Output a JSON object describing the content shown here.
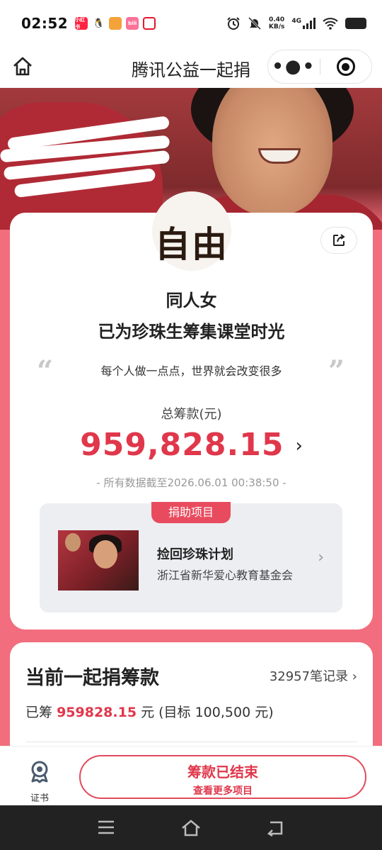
{
  "status": {
    "time": "02:52",
    "net_speed_value": "0.40",
    "net_speed_unit": "KB/s",
    "net_type": "4G",
    "apps": [
      {
        "name": "xiaohongshu-app-icon",
        "label": "小红书",
        "color": "#ff2442"
      },
      {
        "name": "qq-app-icon",
        "label": "🐧",
        "color": "#ffffff"
      },
      {
        "name": "app-icon-orange",
        "label": "",
        "color": "#f4a23a"
      },
      {
        "name": "bilibili-app-icon",
        "label": "bili",
        "color": "#fb7299"
      },
      {
        "name": "weibo-app-icon",
        "label": "",
        "color": "#e6162d"
      }
    ]
  },
  "navbar": {
    "title": "腾讯公益一起捐"
  },
  "donor_card": {
    "avatar_text": "自由",
    "donor_name": "同人女",
    "donated_to": "已为珍珠生筹集课堂时光",
    "slogan": "每个人做一点点，世界就会改变很多",
    "total_label": "总筹款(元)",
    "total_amount": "959,828.15",
    "as_of": "- 所有数据截至2026.06.01 00:38:50 -"
  },
  "project": {
    "tag": "捐助项目",
    "title": "捡回珍珠计划",
    "org": "浙江省新华爱心教育基金会"
  },
  "group_card": {
    "title": "当前一起捐筹款",
    "records": "32957笔记录",
    "raised_prefix": "已筹",
    "raised_amount": "959828.15",
    "raised_suffix": "元 (目标 100,500 元)"
  },
  "bottom": {
    "cert_label": "证书",
    "ended_main": "筹款已结束",
    "ended_sub": "查看更多项目"
  },
  "colors": {
    "accent": "#e0374b",
    "page_bg": "#f26d7d",
    "tag_bg": "#e94b5e"
  }
}
